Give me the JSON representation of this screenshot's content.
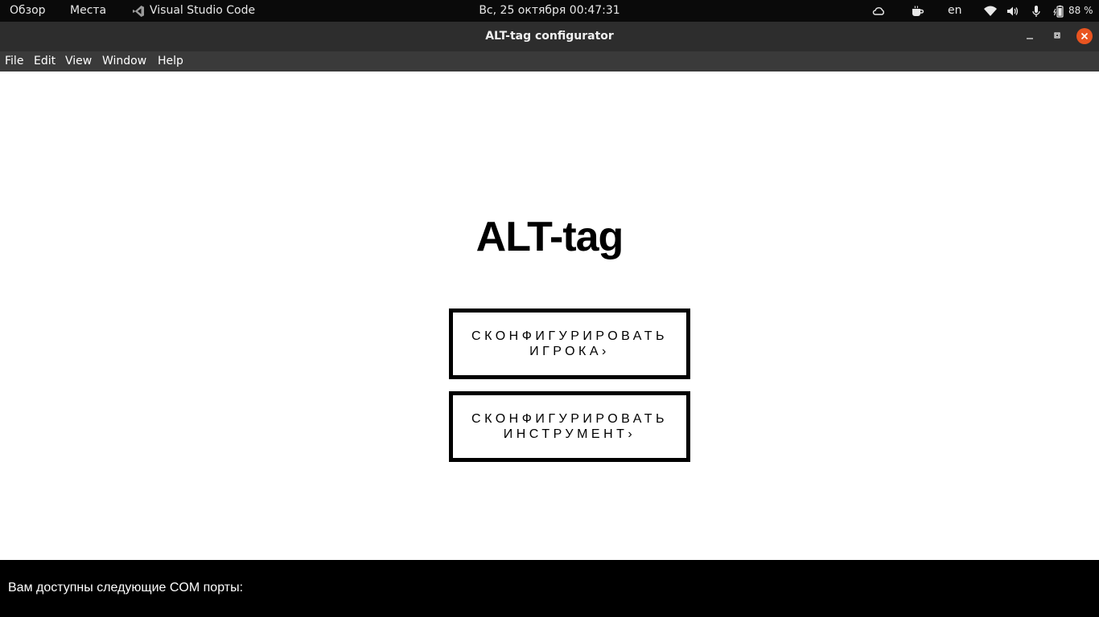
{
  "topbar": {
    "overview": "Обзор",
    "places": "Места",
    "active_app": "Visual Studio Code",
    "clock": "Вс, 25 октября  00:47:31",
    "keyboard_layout": "en",
    "battery_percent": "88 %"
  },
  "window": {
    "title": "ALT-tag configurator"
  },
  "menu": {
    "file": "File",
    "edit": "Edit",
    "view": "View",
    "window": "Window",
    "help": "Help"
  },
  "main": {
    "heading": "ALT-tag",
    "configure_player": "СКОНФИГУРИРОВАТЬ ИГРОКА›",
    "configure_instrument": "СКОНФИГУРИРОВАТЬ ИНСТРУМЕНТ›"
  },
  "footer": {
    "ports_label": "Вам доступны следующие COM порты:"
  },
  "colors": {
    "close_button": "#e95420",
    "footer_bg": "#000000",
    "titlebar_bg": "#2d2d2d",
    "menubar_bg": "#3a3a3a"
  }
}
